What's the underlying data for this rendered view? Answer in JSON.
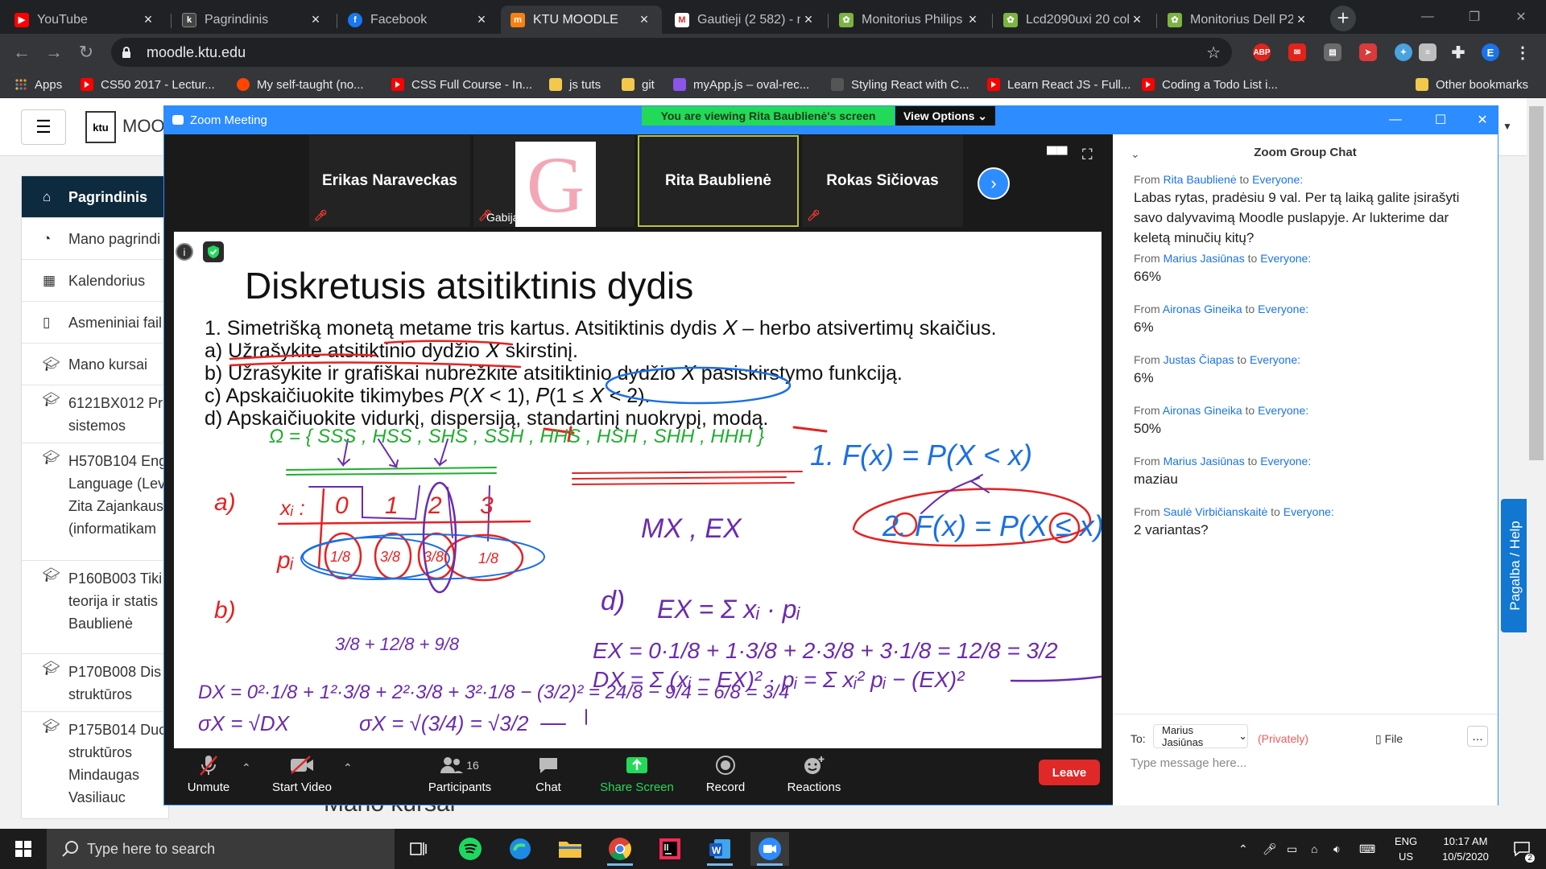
{
  "browser": {
    "tabs": [
      {
        "title": "YouTube",
        "icon": "youtube-icon"
      },
      {
        "title": "Pagrindinis",
        "icon": "ktu-icon"
      },
      {
        "title": "Facebook",
        "icon": "facebook-icon"
      },
      {
        "title": "KTU MOODLE",
        "icon": "moodle-icon",
        "active": true
      },
      {
        "title": "Gautieji (2 582) - n",
        "icon": "gmail-icon"
      },
      {
        "title": "Monitorius Philips",
        "icon": "shop-icon"
      },
      {
        "title": "Lcd2090uxi 20 coll",
        "icon": "shop-icon"
      },
      {
        "title": "Monitorius Dell P2",
        "icon": "shop-icon"
      }
    ],
    "url": "moodle.ktu.edu",
    "profile_initial": "E",
    "extensions": [
      "abp-icon",
      "mail-ext-icon",
      "tabs-ext-icon",
      "arrow-ext-icon",
      "ext-blue-icon",
      "db-ext-icon",
      "puzzle-icon"
    ],
    "bookmarks": [
      {
        "label": "Apps",
        "icon": "apps-grid-icon"
      },
      {
        "label": "CS50 2017 - Lectur...",
        "icon": "youtube-icon"
      },
      {
        "label": "My self-taught (no...",
        "icon": "reddit-icon"
      },
      {
        "label": "CSS Full Course - In...",
        "icon": "youtube-icon"
      },
      {
        "label": "js tuts",
        "icon": "folder-icon"
      },
      {
        "label": "git",
        "icon": "folder-icon"
      },
      {
        "label": "myApp.js – oval-rec...",
        "icon": "glitch-icon"
      },
      {
        "label": "Styling React with C...",
        "icon": "bookmark-icon"
      },
      {
        "label": "Learn React JS - Full...",
        "icon": "youtube-icon"
      },
      {
        "label": "Coding a Todo List i...",
        "icon": "youtube-icon"
      }
    ],
    "other_bookmarks": "Other bookmarks"
  },
  "moodle": {
    "site_name": "MOO",
    "logo_text": "ktu",
    "nav": [
      {
        "label": "Pagrindinis",
        "icon": "home-icon",
        "active": true
      },
      {
        "label": "Mano pagrindi",
        "icon": "dashboard-icon"
      },
      {
        "label": "Kalendorius",
        "icon": "calendar-icon"
      },
      {
        "label": "Asmeniniai fail",
        "icon": "file-icon"
      },
      {
        "label": "Mano kursai",
        "icon": "graduation-cap-icon"
      }
    ],
    "courses": [
      {
        "lines": [
          "6121BX012 Pr",
          "sistemos"
        ]
      },
      {
        "lines": [
          "H570B104 Eng",
          "Language (Lev",
          "Zita Zajankaus",
          "(informatikam"
        ]
      },
      {
        "lines": [
          "P160B003 Tiki",
          "teorija ir statis",
          "Baublienė"
        ]
      },
      {
        "lines": [
          "P170B008 Dis",
          "struktūros"
        ]
      },
      {
        "lines": [
          "P175B014 Duc",
          "struktūros Mindaugas",
          "Vasiliauc"
        ]
      }
    ],
    "main_heading": "Mano kursai",
    "help_tab": "Pagalba / Help"
  },
  "zoom": {
    "window_title": "Zoom Meeting",
    "viewing_banner": "You are viewing Rita Baublienė's screen",
    "view_options": "View Options",
    "participants": [
      {
        "name": "Erikas Naraveckas",
        "muted": true
      },
      {
        "name": "Gabija Vaivad...",
        "muted": true,
        "avatar_letter": "G"
      },
      {
        "name": "Rita Baublienė",
        "speaking": true
      },
      {
        "name": "Rokas Sičiovas",
        "muted": true
      }
    ],
    "shared": {
      "title": "Diskretusis atsitiktinis dydis",
      "lines": [
        "1.  Simetrišką monetą metame tris kartus. Atsitiktinis dydis 𝑋 – herbo atsivertimų skaičius.",
        "a) Užrašykite atsitiktinio dydžio 𝑋 skirstinį.",
        "b) Užrašykite ir grafiškai nubrėžkite atsitiktinio dydžio 𝑋 pasiskirstymo funkciją.",
        "c) Apskaičiuokite tikimybes 𝑃(𝑋 < 1), 𝑃(1 ≤ 𝑋 < 2).",
        "d) Apskaičiuokite vidurkį, dispersiją, standartinį nuokrypį, modą."
      ],
      "handwriting": {
        "omega": "Ω = { SSS , HSS , SHS , SSH ,  HHS , HSH , SHH , HHH }",
        "label_a": "a)",
        "xi": "xᵢ :",
        "x_values": [
          "0",
          "1",
          "2",
          "3"
        ],
        "pi": "pᵢ",
        "p_values": [
          "1/8",
          "3/8",
          "3/8",
          "1/8"
        ],
        "f1": "1.  F(x) = P(X < x)",
        "f2": "2.  F(x) = P(X ≤ x)",
        "mx": "MX ,  EX",
        "label_b": "b)",
        "label_d": "d)",
        "ex_def": "EX = Σ xᵢ · pᵢ",
        "ex_calc": "EX = 0·1/8 + 1·3/8 + 2·3/8 + 3·1/8 = 12/8 = 3/2",
        "side_sum": "3/8 + 12/8 + 9/8",
        "dx_left": "DX = 0²·1/8 + 1²·3/8 + 2²·3/8 + 3²·1/8 − (3/2)² = 24/8 − 9/4 = 6/8 = 3/4",
        "dx_right": "DX = Σ (xᵢ − EX)² · pᵢ = Σ xᵢ² pᵢ − (EX)²",
        "sigma1": "σX = √DX",
        "sigma2": "σX = √(3/4) = √3/2"
      }
    },
    "toolbar": [
      {
        "label": "Unmute",
        "icon": "mic-muted-icon"
      },
      {
        "label": "Start Video",
        "icon": "video-off-icon"
      },
      {
        "label": "Participants",
        "icon": "participants-icon",
        "count": "16"
      },
      {
        "label": "Chat",
        "icon": "chat-icon"
      },
      {
        "label": "Share Screen",
        "icon": "share-screen-icon"
      },
      {
        "label": "Record",
        "icon": "record-icon"
      },
      {
        "label": "Reactions",
        "icon": "reactions-icon"
      }
    ],
    "leave": "Leave",
    "chat": {
      "title": "Zoom Group Chat",
      "messages": [
        {
          "from": "Rita Baublienė",
          "to": "Everyone:",
          "text": "Labas rytas, pradėsiu 9 val. Per tą laiką galite įsirašyti savo dalyvavimą Moodle puslapyje. Ar lukterime dar keletą minučių kitų?"
        },
        {
          "from": "Marius Jasiūnas",
          "to": "Everyone:",
          "text": "66%"
        },
        {
          "from": "Aironas Gineika",
          "to": "Everyone:",
          "text": "6%"
        },
        {
          "from": "Justas Čiapas",
          "to": "Everyone:",
          "text": "6%"
        },
        {
          "from": "Aironas Gineika",
          "to": "Everyone:",
          "text": "50%"
        },
        {
          "from": "Marius Jasiūnas",
          "to": "Everyone:",
          "text": "maziau"
        },
        {
          "from": "Saulė Virbičianskaitė",
          "to": "Everyone:",
          "text": "2 variantas?"
        }
      ],
      "from_word": "From",
      "to_word": "to",
      "to_label": "To:",
      "recipient": "Marius Jasiūnas",
      "privately": "(Privately)",
      "file": "File",
      "placeholder": "Type message here..."
    }
  },
  "taskbar": {
    "search_placeholder": "Type here to search",
    "apps": [
      "task-view-icon",
      "spotify-icon",
      "edge-icon",
      "file-explorer-icon",
      "chrome-icon",
      "intellij-icon",
      "word-icon",
      "zoom-icon"
    ],
    "lang": "ENG",
    "region": "US",
    "time": "10:17 AM",
    "date": "10/5/2020",
    "notifications": "2"
  },
  "colors": {
    "zoom_blue": "#2d8cff",
    "banner_green": "#23d959",
    "leave_red": "#e02828",
    "ink_red": "#e52222",
    "ink_purple": "#6a2bb0",
    "ink_green": "#1fae2e",
    "ink_blue": "#1a6fe6",
    "moodle_nav": "#0d2a3e"
  }
}
